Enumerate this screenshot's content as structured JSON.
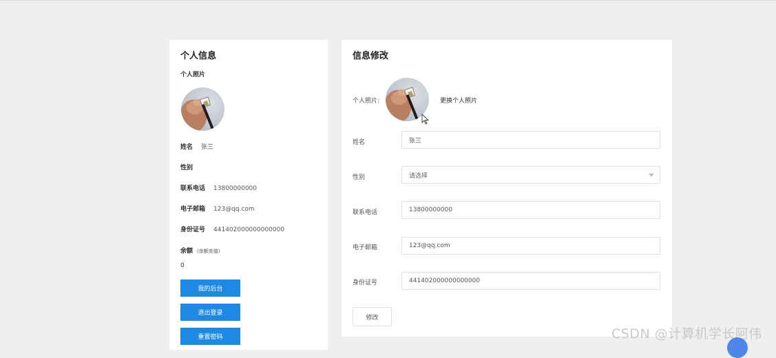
{
  "profile": {
    "title": "个人信息",
    "photo_label": "个人照片",
    "name_label": "姓名",
    "name_value": "张三",
    "gender_label": "性别",
    "gender_value": "",
    "phone_label": "联系电话",
    "phone_value": "13800000000",
    "email_label": "电子邮箱",
    "email_value": "123@qq.com",
    "id_label": "身份证号",
    "id_value": "441402000000000000",
    "balance_label": "余额",
    "balance_hint": "(余额充值)",
    "balance_value": "0",
    "buttons": {
      "dashboard": "我的后台",
      "logout": "退出登录",
      "reset_password": "重置密码"
    }
  },
  "edit_form": {
    "title": "信息修改",
    "photo_label": "个人照片:",
    "change_photo": "更换个人照片",
    "name_label": "姓名",
    "name_value": "张三",
    "gender_label": "性别",
    "gender_placeholder": "请选择",
    "phone_label": "联系电话",
    "phone_value": "13800000000",
    "email_label": "电子邮箱",
    "email_value": "123@qq.com",
    "id_label": "身份证号",
    "id_value": "441402000000000000",
    "submit": "修改"
  },
  "watermark": "CSDN @计算机学长阿伟",
  "colors": {
    "primary": "#1e88e5",
    "background": "#efeff1"
  },
  "icons": {
    "avatar": "avatar-photo-hand-with-tool",
    "select_arrow": "chevron-down-icon",
    "cursor": "mouse-pointer-icon"
  }
}
